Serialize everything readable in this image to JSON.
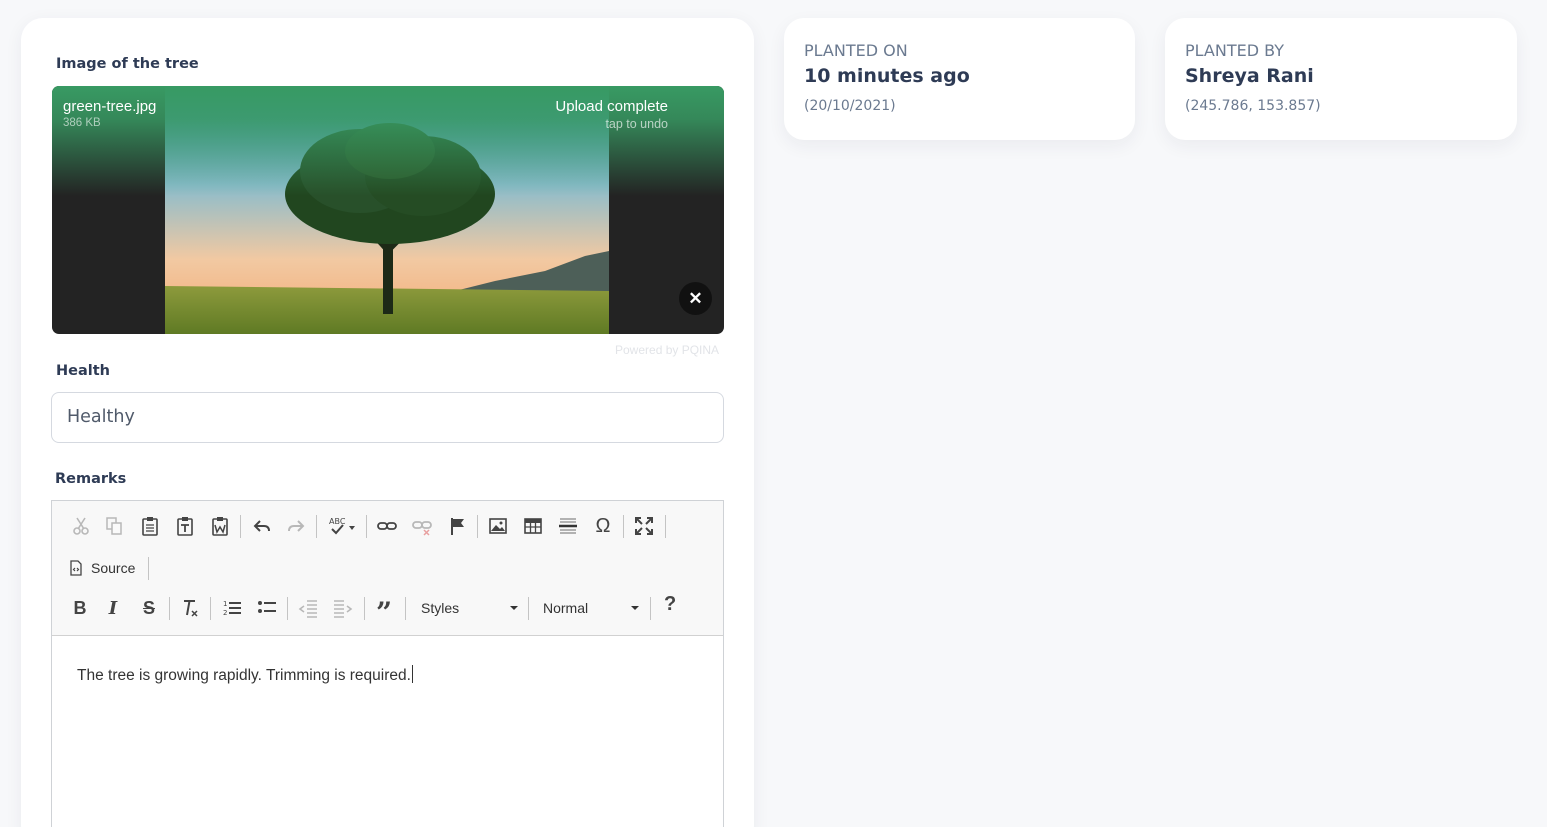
{
  "image_section": {
    "label": "Image of the tree",
    "file_name": "green-tree.jpg",
    "file_size": "386 KB",
    "status": "Upload complete",
    "undo_hint": "tap to undo",
    "remove_icon": "close-icon",
    "powered_by": "Powered by PQINA"
  },
  "health": {
    "label": "Health",
    "value": "Healthy"
  },
  "remarks": {
    "label": "Remarks",
    "toolbar": {
      "source_label": "Source",
      "styles_label": "Styles",
      "format_label": "Normal",
      "help_label": "?"
    },
    "content": "The tree is growing rapidly. Trimming is required."
  },
  "planted_on": {
    "title": "PLANTED ON",
    "value": "10 minutes ago",
    "detail": "(20/10/2021)"
  },
  "planted_by": {
    "title": "PLANTED BY",
    "value": "Shreya Rani",
    "detail": "(245.786, 153.857)"
  },
  "colors": {
    "upload_green": "#389a63",
    "text_dark": "#2e3b55",
    "text_muted": "#6b7a90"
  }
}
